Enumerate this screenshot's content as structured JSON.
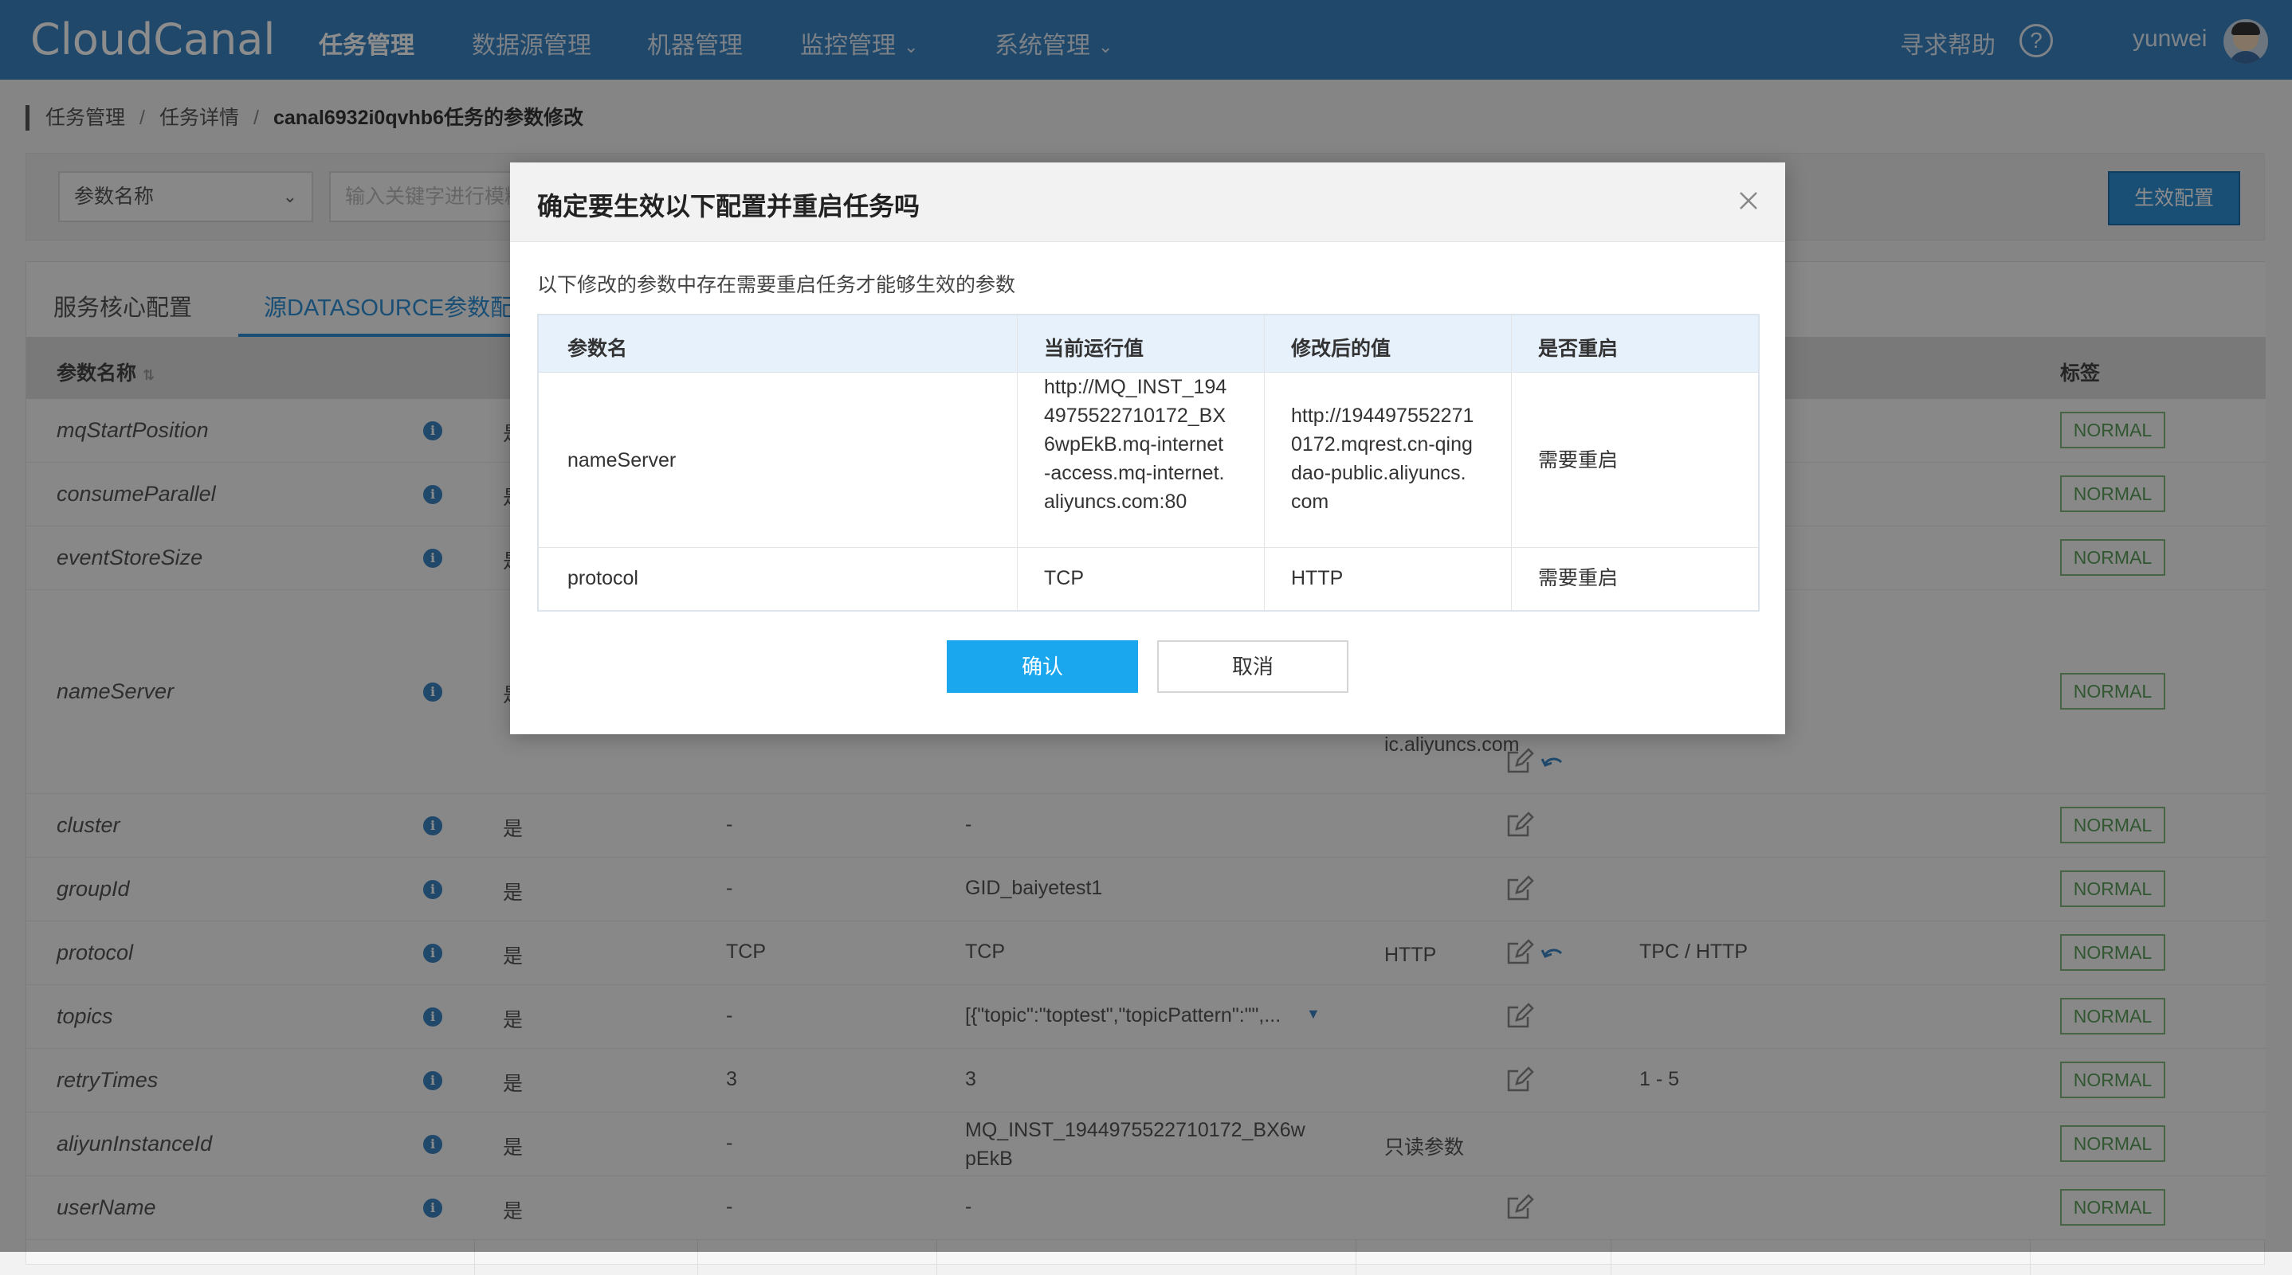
{
  "nav": {
    "logo": "CloudCanal",
    "items": [
      "任务管理",
      "数据源管理",
      "机器管理",
      "监控管理",
      "系统管理"
    ],
    "help": "寻求帮助",
    "user": "yunwei"
  },
  "breadcrumb": {
    "items": [
      "任务管理",
      "任务详情",
      "canal6932i0qvhb6任务的参数修改"
    ]
  },
  "filter": {
    "select_value": "参数名称",
    "search_placeholder": "输入关键字进行模糊",
    "apply_label": "生效配置"
  },
  "tabs": [
    "服务核心配置",
    "源DATASOURCE参数配置"
  ],
  "table": {
    "col_param": "参数名称",
    "col_tag": "标签",
    "rows": [
      {
        "name": "mqStartPosition",
        "restart": "是",
        "tag": "NORMAL"
      },
      {
        "name": "consumeParallel",
        "restart": "是",
        "tag": "NORMAL"
      },
      {
        "name": "eventStoreSize",
        "restart": "是",
        "tag": "NORMAL"
      },
      {
        "name": "nameServer",
        "restart": "是",
        "modified": "ic.aliyuncs.com",
        "tag": "NORMAL"
      },
      {
        "name": "cluster",
        "restart": "是",
        "default": "-",
        "current": "-",
        "tag": "NORMAL"
      },
      {
        "name": "groupId",
        "restart": "是",
        "default": "-",
        "current": "GID_baiyetest1",
        "tag": "NORMAL"
      },
      {
        "name": "protocol",
        "restart": "是",
        "default": "TCP",
        "current": "TCP",
        "modified": "HTTP",
        "range": "TPC / HTTP",
        "tag": "NORMAL"
      },
      {
        "name": "topics",
        "restart": "是",
        "default": "-",
        "current": "[{\"topic\":\"toptest\",\"topicPattern\":\"\",...",
        "tag": "NORMAL"
      },
      {
        "name": "retryTimes",
        "restart": "是",
        "default": "3",
        "current": "3",
        "range": "1 - 5",
        "tag": "NORMAL"
      },
      {
        "name": "aliyunInstanceId",
        "restart": "是",
        "default": "-",
        "current": "MQ_INST_1944975522710172_BX6wpEkB",
        "modified": "只读参数",
        "tag": "NORMAL"
      },
      {
        "name": "userName",
        "restart": "是",
        "default": "-",
        "current": "-",
        "tag": "NORMAL"
      }
    ]
  },
  "modal": {
    "title": "确定要生效以下配置并重启任务吗",
    "desc": "以下修改的参数中存在需要重启任务才能够生效的参数",
    "headers": [
      "参数名",
      "当前运行值",
      "修改后的值",
      "是否重启"
    ],
    "rows": [
      {
        "name": "nameServer",
        "current": "http://MQ_INST_1944975522710172_BX6wpEkB.mq-internet-access.mq-internet.aliyuncs.com:80",
        "modified": "http://1944975522710172.mqrest.cn-qingdao-public.aliyuncs.com",
        "restart": "需要重启"
      },
      {
        "name": "protocol",
        "current": "TCP",
        "modified": "HTTP",
        "restart": "需要重启"
      }
    ],
    "confirm_label": "确认",
    "cancel_label": "取消"
  }
}
